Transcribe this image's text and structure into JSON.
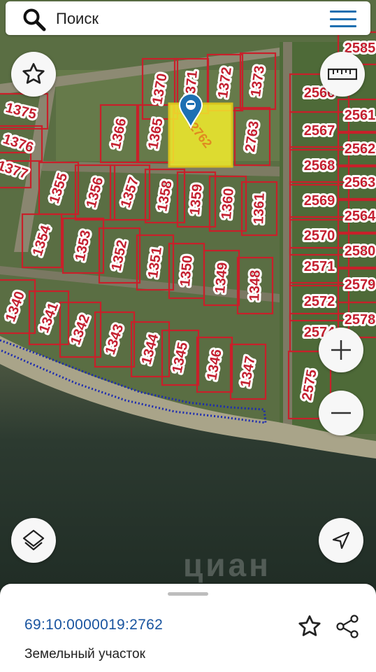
{
  "search": {
    "placeholder": "Поиск"
  },
  "map": {
    "watermark": "циан",
    "parcels": [
      "2566",
      "2567",
      "2568",
      "2569",
      "2570",
      "2571",
      "2572",
      "2574",
      "2575",
      "1375",
      "1376",
      "1377",
      "1370",
      "1371",
      "1372",
      "1373",
      "1366",
      "1365",
      "2762",
      "2763",
      "1355",
      "1356",
      "1357",
      "1358",
      "1359",
      "1360",
      "1361",
      "1354",
      "1353",
      "1352",
      "1351",
      "1350",
      "1349",
      "1348",
      "1340",
      "1341",
      "1342",
      "1343",
      "1344",
      "1345",
      "1346",
      "1347",
      "2580",
      "2579",
      "2578",
      "2585",
      "2561",
      "2562",
      "2563",
      "2564"
    ],
    "selected_parcel": "2762"
  },
  "sheet": {
    "cadastral_number": "69:10:0000019:2762",
    "parcel_type": "Земельный участок"
  },
  "colors": {
    "boundary": "#c8202a",
    "label_text": "#c42030",
    "selected_fill": "#f2ec2c",
    "accent": "#1e6fb0",
    "water": "#1e2b23"
  }
}
